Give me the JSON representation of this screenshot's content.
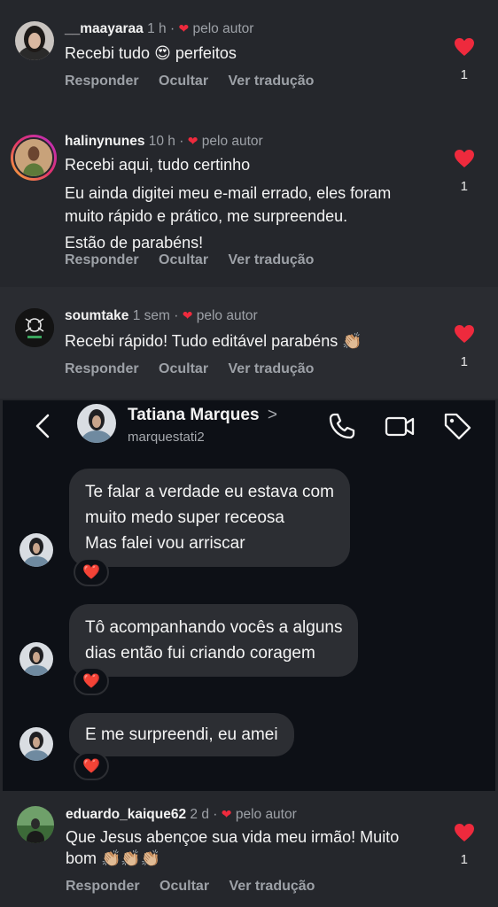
{
  "comments": [
    {
      "username": "__maayaraa",
      "time": "1 h",
      "author_tag": "pelo autor",
      "lines": [
        "Recebi tudo 😍 perfeitos"
      ],
      "actions": [
        "Responder",
        "Ocultar",
        "Ver tradução"
      ],
      "likes": "1"
    },
    {
      "username": "halinynunes",
      "time": "10 h",
      "author_tag": "pelo autor",
      "lines": [
        "Recebi aqui, tudo certinho",
        "Eu ainda digitei meu e-mail errado, eles foram",
        "muito rápido e prático, me surpreendeu.",
        "Estão de parabéns!"
      ],
      "actions": [
        "Responder",
        "Ocultar",
        "Ver tradução"
      ],
      "likes": "1"
    },
    {
      "username": "soumtake",
      "time": "1 sem",
      "author_tag": "pelo autor",
      "lines": [
        "Recebi rápido! Tudo editável parabéns 👏🏼"
      ],
      "actions": [
        "Responder",
        "Ocultar",
        "Ver tradução"
      ],
      "likes": "1"
    },
    {
      "username": "eduardo_kaique62",
      "time": "2 d",
      "author_tag": "pelo autor",
      "lines": [
        "Que Jesus abençoe sua vida meu irmão! Muito",
        "bom 👏🏼👏🏼👏🏼"
      ],
      "actions": [
        "Responder",
        "Ocultar",
        "Ver tradução"
      ],
      "likes": "1"
    }
  ],
  "dm": {
    "contact_name": "Tatiana Marques",
    "chevron": ">",
    "handle": "marquestati2",
    "messages": [
      {
        "lines": [
          "Te falar a verdade eu estava com",
          "muito medo super receosa",
          "Mas falei vou arriscar"
        ],
        "reaction": "❤️"
      },
      {
        "lines": [
          "Tô acompanhando vocês a alguns",
          "dias então fui criando coragem"
        ],
        "reaction": "❤️"
      },
      {
        "lines": [
          "E me surpreendi, eu amei"
        ],
        "reaction": "❤️"
      }
    ]
  },
  "colors": {
    "heart_red": "#ee2a3d",
    "comment_bg": "#25272c",
    "dm_bg": "#0d1016",
    "bubble_bg": "#2c2e33",
    "muted_text": "#9da1a7"
  },
  "icons": {
    "back": "chevron-left-icon",
    "call": "phone-icon",
    "video": "video-camera-icon",
    "tag": "tag-icon",
    "like": "heart-icon"
  }
}
